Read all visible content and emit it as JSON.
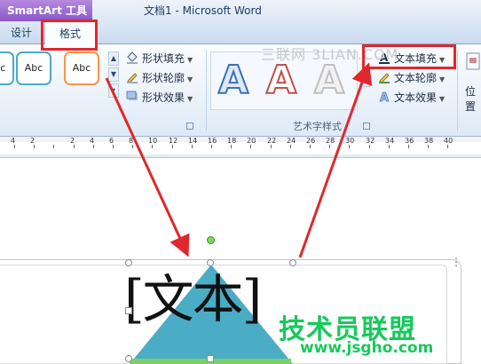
{
  "titlebar": {
    "tools_tab": "SmartArt 工具",
    "doc_title": "文档1 - Microsoft Word"
  },
  "tabs": {
    "design": "设计",
    "format": "格式"
  },
  "ribbon": {
    "shape_styles": {
      "samples": [
        "Abc",
        "Abc",
        "Abc"
      ],
      "shape_fill": "形状填充",
      "shape_outline": "形状轮廓",
      "shape_effects": "形状效果"
    },
    "wordart": {
      "samples": [
        "A",
        "A",
        "A"
      ],
      "text_fill": "文本填充",
      "text_outline": "文本轮廓",
      "text_effects": "文本效果",
      "group_label": "艺术字样式"
    },
    "position": "位置",
    "watermark_top": "三联网 3LIAN.COM"
  },
  "ruler": {
    "ticks": [
      "4",
      "2",
      "",
      "2",
      "4",
      "6",
      "8",
      "10",
      "12",
      "14",
      "16",
      "18",
      "20",
      "22",
      "24",
      "26",
      "28",
      "30",
      "32",
      "34",
      "36",
      "38",
      "40"
    ]
  },
  "document": {
    "smartart_text": "[文本]",
    "watermark": "技术员联盟",
    "watermark_url": "www.jsgho.com"
  },
  "colors": {
    "highlight": "#e0282c",
    "triangle": "#4bacc6",
    "tools_tab": "#8a55c7",
    "watermark": "#16c95b"
  }
}
